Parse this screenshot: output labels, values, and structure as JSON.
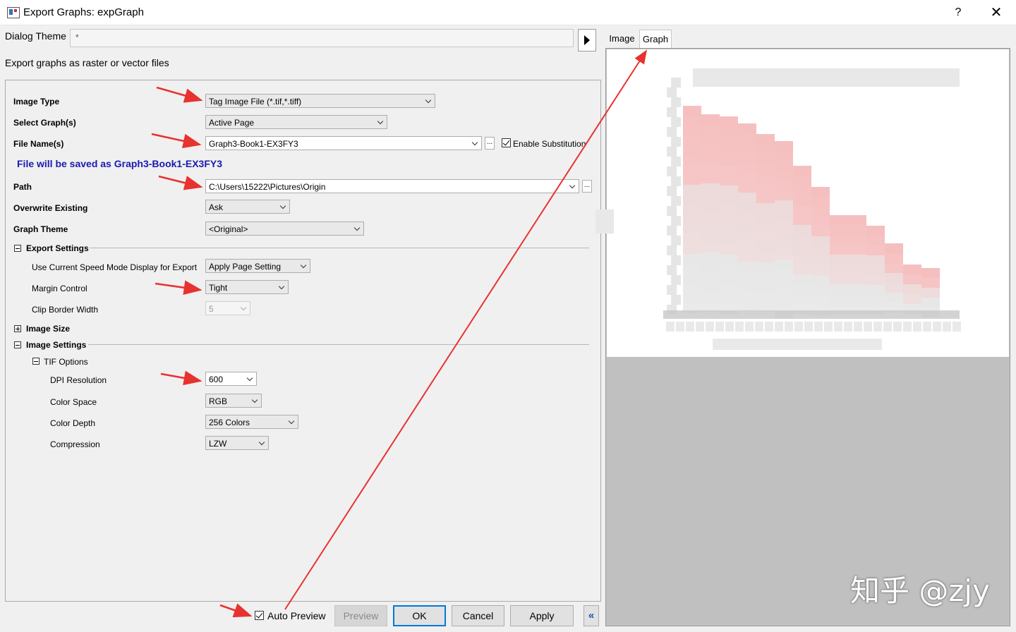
{
  "window": {
    "title": "Export Graphs: expGraph",
    "help_label": "?",
    "close_label": "✕"
  },
  "theme": {
    "label": "Dialog Theme",
    "value": "*"
  },
  "description": "Export graphs as raster or vector files",
  "fields": {
    "image_type": {
      "label": "Image Type",
      "value": "Tag Image File (*.tif,*.tiff)"
    },
    "select_graphs": {
      "label": "Select Graph(s)",
      "value": "Active Page"
    },
    "file_name": {
      "label": "File Name(s)",
      "value": "Graph3-Book1-EX3FY3",
      "ellipsis": "...",
      "substitution_label": "Enable Substitution"
    },
    "saved_note": "File will be saved as Graph3-Book1-EX3FY3",
    "path": {
      "label": "Path",
      "value": "C:\\Users\\15222\\Pictures\\Origin",
      "ellipsis": "..."
    },
    "overwrite": {
      "label": "Overwrite Existing",
      "value": "Ask"
    },
    "graph_theme": {
      "label": "Graph Theme",
      "value": "<Original>"
    }
  },
  "export_settings": {
    "header": "Export Settings",
    "speed_mode": {
      "label": "Use Current Speed Mode Display for Export",
      "value": "Apply Page Setting"
    },
    "margin": {
      "label": "Margin Control",
      "value": "Tight"
    },
    "clip_border": {
      "label": "Clip Border Width",
      "value": "5"
    }
  },
  "image_size": {
    "header": "Image Size"
  },
  "image_settings": {
    "header": "Image Settings",
    "tif_header": "TIF Options",
    "dpi": {
      "label": "DPI Resolution",
      "value": "600"
    },
    "color_space": {
      "label": "Color Space",
      "value": "RGB"
    },
    "color_depth": {
      "label": "Color Depth",
      "value": "256 Colors"
    },
    "compression": {
      "label": "Compression",
      "value": "LZW"
    }
  },
  "footer": {
    "auto_preview": "Auto Preview",
    "preview": "Preview",
    "ok": "OK",
    "cancel": "Cancel",
    "apply": "Apply",
    "collapse": "«"
  },
  "preview_tabs": [
    "Image",
    "Graph"
  ],
  "watermark": "知乎 @zjy",
  "colors": {
    "accent": "#0078d7",
    "note": "#1a1ab0",
    "arrow": "#e8322f",
    "bar": "#f4b8b8"
  }
}
